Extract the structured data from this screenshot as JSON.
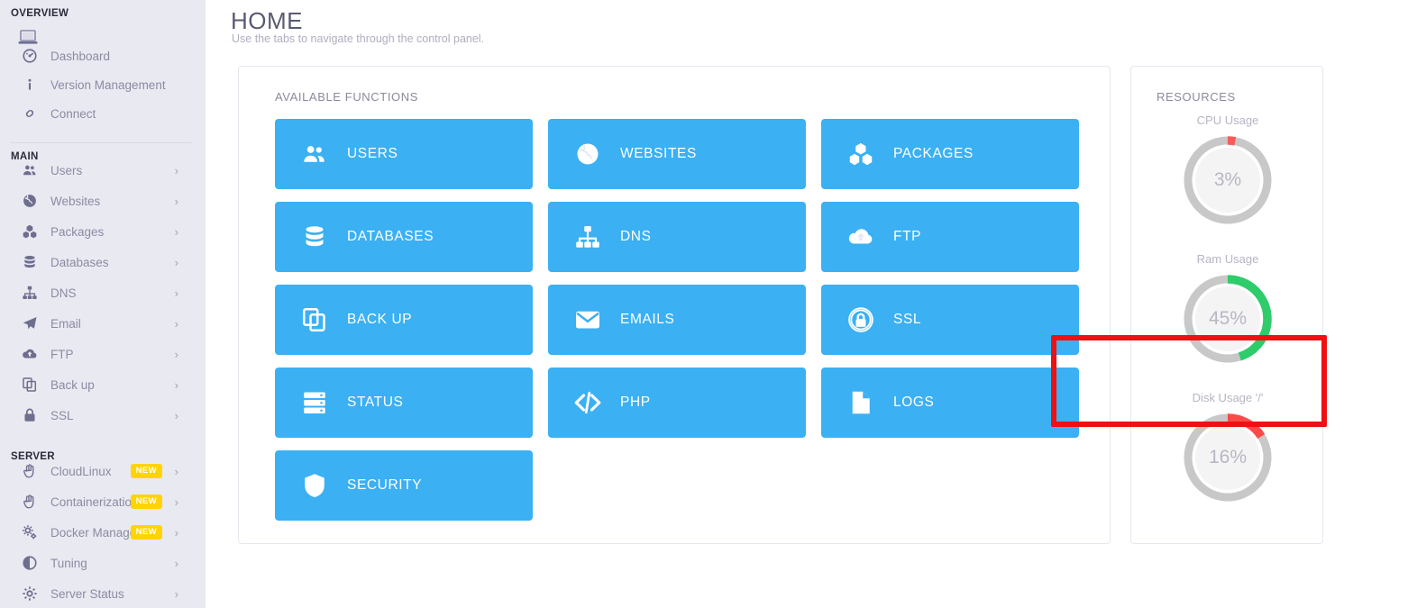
{
  "sidebar": {
    "sections": [
      {
        "label": "OVERVIEW"
      },
      {
        "label": "MAIN"
      },
      {
        "label": "SERVER"
      }
    ],
    "overview_items": [
      {
        "label": "Dashboard",
        "icon": "gauge-icon",
        "chevron": false,
        "badge": null
      },
      {
        "label": "Version Management",
        "icon": "info-icon",
        "chevron": false,
        "badge": null
      },
      {
        "label": "Connect",
        "icon": "link-icon",
        "chevron": false,
        "badge": null
      }
    ],
    "main_items": [
      {
        "label": "Users",
        "icon": "users-icon",
        "chevron": "›",
        "badge": null
      },
      {
        "label": "Websites",
        "icon": "globe-icon",
        "chevron": "›",
        "badge": null
      },
      {
        "label": "Packages",
        "icon": "packages-icon",
        "chevron": "›",
        "badge": null
      },
      {
        "label": "Databases",
        "icon": "database-icon",
        "chevron": "›",
        "badge": null
      },
      {
        "label": "DNS",
        "icon": "sitemap-icon",
        "chevron": "›",
        "badge": null
      },
      {
        "label": "Email",
        "icon": "paper-plane-icon",
        "chevron": "›",
        "badge": null
      },
      {
        "label": "FTP",
        "icon": "cloud-upload-icon",
        "chevron": "›",
        "badge": null
      },
      {
        "label": "Back up",
        "icon": "copy-icon",
        "chevron": "›",
        "badge": null
      },
      {
        "label": "SSL",
        "icon": "lock-icon",
        "chevron": "›",
        "badge": null
      }
    ],
    "server_items": [
      {
        "label": "CloudLinux",
        "icon": "hand-icon",
        "chevron": "›",
        "badge": "NEW"
      },
      {
        "label": "Containerization",
        "icon": "hand-icon",
        "chevron": "›",
        "badge": "NEW"
      },
      {
        "label": "Docker Manager",
        "icon": "cogs-icon",
        "chevron": "›",
        "badge": "NEW"
      },
      {
        "label": "Tuning",
        "icon": "contrast-icon",
        "chevron": "›",
        "badge": null
      },
      {
        "label": "Server Status",
        "icon": "cog-icon",
        "chevron": "›",
        "badge": null
      }
    ],
    "top_icon": "laptop-icon"
  },
  "header": {
    "title": "HOME",
    "subtitle": "Use the tabs to navigate through the control panel."
  },
  "functions_card": {
    "heading": "AVAILABLE FUNCTIONS",
    "tiles": [
      {
        "label": "USERS",
        "icon": "users-icon"
      },
      {
        "label": "WEBSITES",
        "icon": "globe-icon"
      },
      {
        "label": "PACKAGES",
        "icon": "packages-icon"
      },
      {
        "label": "DATABASES",
        "icon": "database-icon"
      },
      {
        "label": "DNS",
        "icon": "sitemap-icon"
      },
      {
        "label": "FTP",
        "icon": "cloud-upload-icon"
      },
      {
        "label": "BACK UP",
        "icon": "copy-icon"
      },
      {
        "label": "EMAILS",
        "icon": "envelope-icon"
      },
      {
        "label": "SSL",
        "icon": "lock-shield-icon"
      },
      {
        "label": "STATUS",
        "icon": "server-icon"
      },
      {
        "label": "PHP",
        "icon": "code-icon"
      },
      {
        "label": "LOGS",
        "icon": "file-icon"
      },
      {
        "label": "SECURITY",
        "icon": "shield-icon"
      }
    ],
    "highlighted_tile": "SSL"
  },
  "resources_card": {
    "heading": "RESOURCES",
    "gauges": [
      {
        "title": "CPU Usage",
        "value": "3%",
        "percent": 3,
        "color": "#fb5a5a"
      },
      {
        "title": "Ram Usage",
        "value": "45%",
        "percent": 45,
        "color": "#2ecc6a"
      },
      {
        "title": "Disk Usage '/'",
        "value": "16%",
        "percent": 16,
        "color": "#fb4a4a"
      }
    ]
  },
  "colors": {
    "tile_blue": "#3bb0f3",
    "sidebar_bg": "#e9e9f2",
    "highlight_red": "#ee1111",
    "badge_yellow": "#ffd400",
    "gauge_track": "#c8c8c8"
  }
}
